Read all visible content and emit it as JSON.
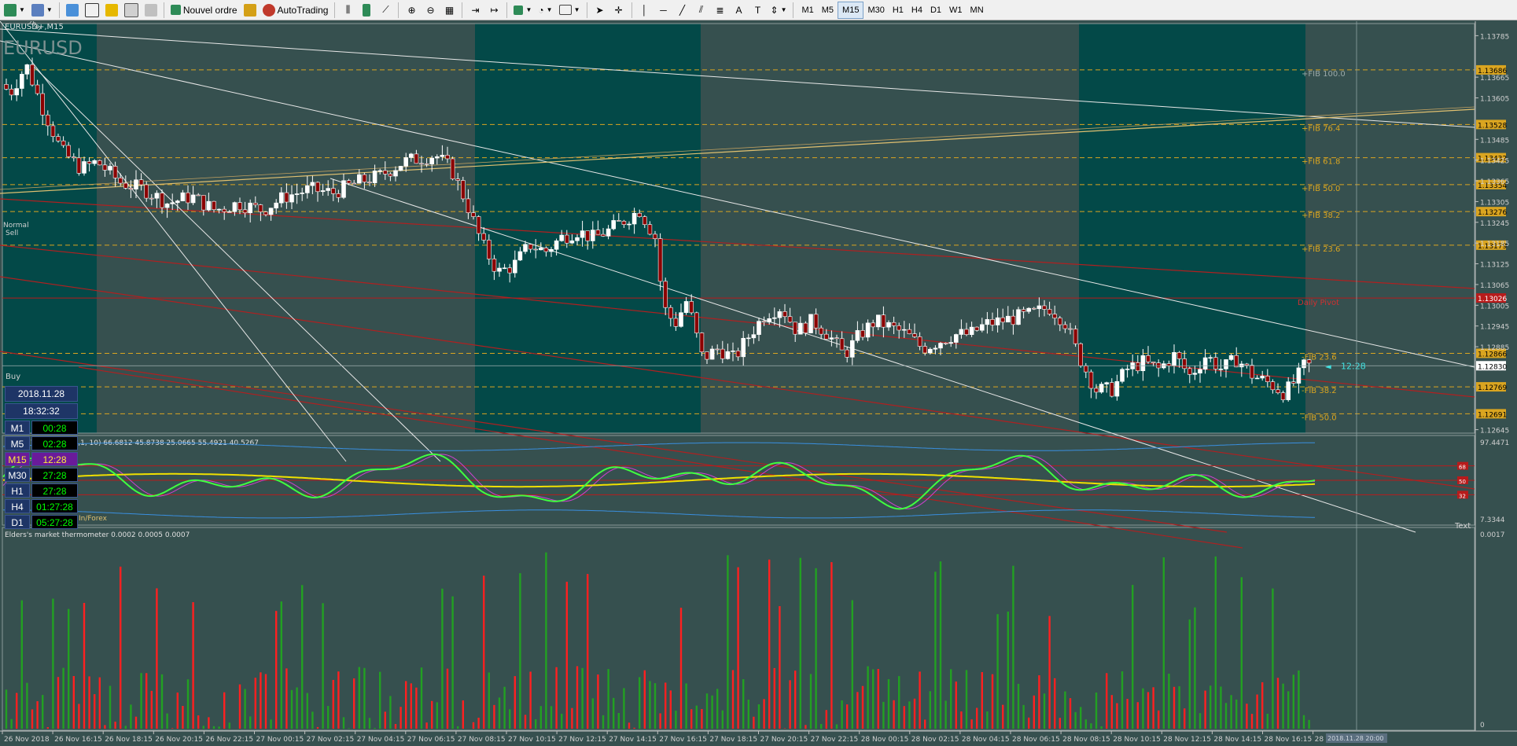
{
  "toolbar": {
    "new_order": "Nouvel ordre",
    "autotrading": "AutoTrading",
    "timeframes": [
      "M1",
      "M5",
      "M15",
      "M30",
      "H1",
      "H4",
      "D1",
      "W1",
      "MN"
    ],
    "active_timeframe": "M15"
  },
  "chart": {
    "symbol_header": "EURUSD+,M15",
    "watermark": "EURUSD",
    "signal_top": "Normal",
    "signal_left_1": "Normal",
    "signal_left_2": "Sell",
    "buy_label": "Buy",
    "broker_label": "In/Forex",
    "price_ticks": [
      "1.13785",
      "1.13665",
      "1.13605",
      "1.13485",
      "1.13425",
      "1.13365",
      "1.13305",
      "1.13245",
      "1.13185",
      "1.13125",
      "1.13065",
      "1.13005",
      "1.12945",
      "1.12885",
      "1.12830",
      "1.12769",
      "1.12691",
      "1.12645"
    ],
    "fib_upper": [
      {
        "label": "+FIB 100.0",
        "price": "1.13686"
      },
      {
        "label": "+FIB 76.4",
        "price": "1.13528"
      },
      {
        "label": "+FIB 61.8",
        "price": "1.13432"
      },
      {
        "label": "+FIB 50.0",
        "price": "1.13354"
      },
      {
        "label": "+FIB 38.2",
        "price": "1.13276"
      },
      {
        "label": "+FIB 23.6",
        "price": "1.13179"
      }
    ],
    "daily_pivot": {
      "label": "Daily Pivot",
      "price": "1.13026"
    },
    "fib_lower": [
      {
        "label": "-FIB 23.6",
        "price": "1.12866"
      },
      {
        "label": "-FIB 38.2",
        "price": "1.12769"
      },
      {
        "label": "-FIB 50.0",
        "price": "1.12691"
      }
    ],
    "current_price": "1.12830",
    "countdown": "12:28",
    "text_label": "Text",
    "colors": {
      "bg": "#36504f",
      "session": "#034948",
      "fib": "#daa520",
      "pivot": "#b81b1b",
      "trend_white": "#e8e8e8",
      "bull": "#ffffff",
      "bear": "#8b0000"
    }
  },
  "tf_panel": {
    "date": "2018.11.28",
    "time": "18:32:32",
    "rows": [
      {
        "tf": "M1",
        "val": "00:28"
      },
      {
        "tf": "M5",
        "val": "02:28"
      },
      {
        "tf": "M15",
        "val": "12:28"
      },
      {
        "tf": "M30",
        "val": "27:28"
      },
      {
        "tf": "H1",
        "val": "27:28"
      },
      {
        "tf": "H4",
        "val": "01:27:28"
      },
      {
        "tf": "D1",
        "val": "05:27:28"
      }
    ]
  },
  "indicator1": {
    "title": "tdi div: TDI of RSX  (9,1, 10) 66.6812 45.8738 25.0665 55.4921 40.5267",
    "scale_top": "97.4471",
    "scale_bottom": "7.3344",
    "levels": [
      "68",
      "50",
      "32"
    ]
  },
  "indicator2": {
    "title": "Elders's market thermometer 0.0002 0.0005 0.0007",
    "scale_top": "0.0017",
    "scale_bottom": "0"
  },
  "time_axis": {
    "labels": [
      "26 Nov 2018",
      "26 Nov 16:15",
      "26 Nov 18:15",
      "26 Nov 20:15",
      "26 Nov 22:15",
      "27 Nov 00:15",
      "27 Nov 02:15",
      "27 Nov 04:15",
      "27 Nov 06:15",
      "27 Nov 08:15",
      "27 Nov 10:15",
      "27 Nov 12:15",
      "27 Nov 14:15",
      "27 Nov 16:15",
      "27 Nov 18:15",
      "27 Nov 20:15",
      "27 Nov 22:15",
      "28 Nov 00:15",
      "28 Nov 02:15",
      "28 Nov 04:15",
      "28 Nov 06:15",
      "28 Nov 08:15",
      "28 Nov 10:15",
      "28 Nov 12:15",
      "28 Nov 14:15",
      "28 Nov 16:15",
      "28 Nov"
    ],
    "cursor_label": "2018.11.28 20:00"
  }
}
